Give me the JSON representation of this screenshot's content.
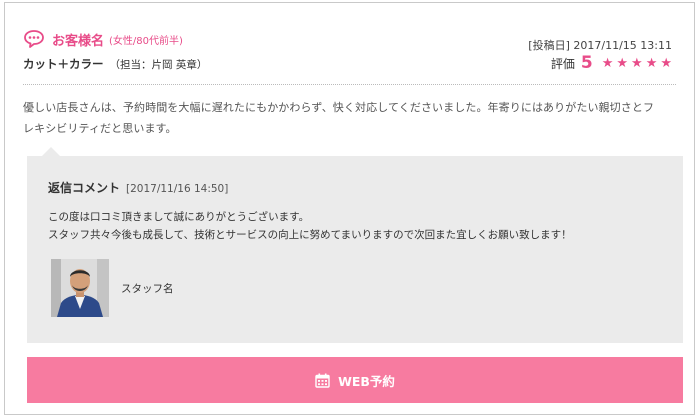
{
  "review": {
    "customer_name": "お客様名",
    "customer_attributes": "(女性/80代前半)",
    "posted_label": "[投稿日]",
    "posted_datetime": "2017/11/15 13:11",
    "menu": "カット＋カラー",
    "staff_in_charge": "（担当：片岡 英章）",
    "rating_label": "評価",
    "rating_value": "5",
    "rating_stars": 5,
    "body_line1": "優しい店長さんは、予約時間を大幅に遅れたにもかかわらず、快く対応してくださいました。年寄りにはありがたい親切さとフ",
    "body_line2": "レキシビリティだと思います。"
  },
  "reply": {
    "title": "返信コメント",
    "datetime": "[2017/11/16 14:50]",
    "body_line1": "この度は口コミ頂きまして誠にありがとうございます。",
    "body_line2": "スタッフ共々今後も成長して、技術とサービスの向上に努めてまいりますので次回また宜しくお願い致します！",
    "staff_name": "スタッフ名"
  },
  "cta": {
    "label": "WEB予約"
  },
  "colors": {
    "accent_pink": "#e84c89",
    "button_pink": "#f77ba0",
    "reply_bg": "#ebebeb"
  },
  "icons": {
    "customer": "speech-bubble-icon",
    "star": "star-icon",
    "cta": "calendar-icon"
  }
}
